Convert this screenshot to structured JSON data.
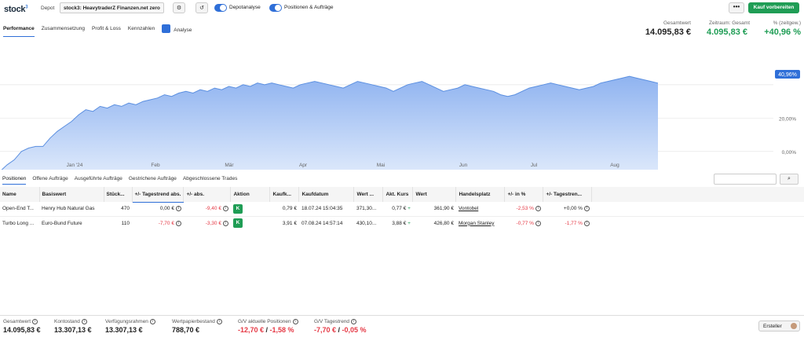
{
  "header": {
    "logo_text": "stock",
    "logo_sup": "3",
    "depot_label": "Depot",
    "depot_value": "stock3: HeavytraderZ Finanzen.net zero",
    "toggle1_label": "Depotanalyse",
    "toggle2_label": "Positionen & Aufträge",
    "more_label": "•••",
    "buy_label": "Kauf vorbereiten"
  },
  "top_tabs": [
    "Performance",
    "Zusammensetzung",
    "Profit & Loss",
    "Kennzahlen",
    "Analyse"
  ],
  "kpis": {
    "gesamtwert_label": "Gesamtwert",
    "gesamtwert": "14.095,83 €",
    "zeitraum_label": "Zeitraum: Gesamt",
    "zeitraum_value": "4.095,83 €",
    "pct_label": "% (zeitgew.)",
    "pct_value": "+40,96 %"
  },
  "chart_data": {
    "type": "area",
    "x_ticks": [
      "Jan '24",
      "Feb",
      "Mär",
      "Apr",
      "Mai",
      "Jun",
      "Jul",
      "Aug"
    ],
    "y_ticks": [
      "20,00%",
      "0,00%"
    ],
    "current_label": "40,96%",
    "series": [
      {
        "values": [
          -12,
          -8,
          -5,
          0,
          2,
          3,
          3,
          8,
          12,
          15,
          18,
          22,
          25,
          24,
          27,
          26,
          28,
          27,
          29,
          28,
          30,
          31,
          32,
          34,
          33,
          35,
          36,
          35,
          37,
          36,
          38,
          37,
          39,
          38,
          40,
          39,
          41,
          40,
          41,
          40,
          39,
          38,
          40,
          41,
          42,
          41,
          40,
          39,
          38,
          40,
          42,
          41,
          40,
          39,
          38,
          36,
          38,
          40,
          41,
          42,
          40,
          38,
          36,
          37,
          38,
          40,
          39,
          38,
          37,
          36,
          34,
          33,
          34,
          36,
          38,
          39,
          40,
          41,
          40,
          39,
          38,
          37,
          38,
          39,
          41,
          42,
          43,
          44,
          45,
          44,
          43,
          42,
          40.96
        ]
      }
    ],
    "y_range": [
      -10,
      55
    ]
  },
  "pos_tabs": [
    "Positionen",
    "Offene Aufträge",
    "Ausgeführte Aufträge",
    "Gestrichene Aufträge",
    "Abgeschlossene Trades"
  ],
  "table": {
    "headers": [
      "Name",
      "Basiswert",
      "Stück...",
      "+/- Tagestrend abs.",
      "+/- abs.",
      "Aktion",
      "Kaufk...",
      "Kaufdatum",
      "Wert ...",
      "Akt. Kurs",
      "Wert",
      "Handelsplatz",
      "+/- in %",
      "+/- Tagestren..."
    ],
    "rows": [
      {
        "name": "Open-End T...",
        "basis": "Henry Hub Natural Gas",
        "stueck": "470",
        "tag_abs": "0,00 €",
        "abs": "-9,40 €",
        "aktion": "K",
        "kaufk": "0,79 €",
        "kaufdatum": "18.07.24 15:04:35",
        "wert1": "371,30...",
        "kurs": "0,77 €",
        "wert": "361,90 €",
        "platz": "Vontobel",
        "pct": "-2,53 %",
        "tag_pct": "+0,00 %"
      },
      {
        "name": "Turbo Long ...",
        "basis": "Euro-Bund Future",
        "stueck": "110",
        "tag_abs": "-7,70 €",
        "abs": "-3,30 €",
        "aktion": "K",
        "kaufk": "3,91 €",
        "kaufdatum": "07.08.24 14:57:14",
        "wert1": "430,10...",
        "kurs": "3,88 €",
        "wert": "426,80 €",
        "platz": "Morgan Stanley",
        "pct": "-0,77 %",
        "tag_pct": "-1,77 %"
      }
    ]
  },
  "footer": {
    "gesamtwert_label": "Gesamtwert",
    "gesamtwert": "14.095,83 €",
    "konto_label": "Kontostand",
    "konto": "13.307,13 €",
    "verf_label": "Verfügungsrahmen",
    "verf": "13.307,13 €",
    "wp_label": "Wertpapierbestand",
    "wp": "788,70 €",
    "gv_akt_label": "G/V aktuelle Positionen",
    "gv_akt_abs": "-12,70 €",
    "gv_akt_sep": " / ",
    "gv_akt_pct": "-1,58 %",
    "gv_tag_label": "G/V Tagestrend",
    "gv_tag_abs": "-7,70 €",
    "gv_tag_sep": " / ",
    "gv_tag_pct": "-0,05 %",
    "ersteller_label": "Ersteller"
  }
}
